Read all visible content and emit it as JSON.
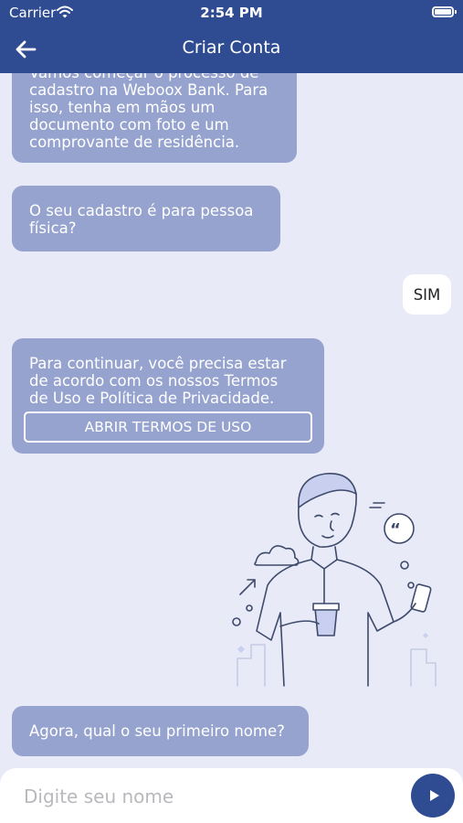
{
  "status_bar": {
    "carrier": "Carrier",
    "time": "2:54 PM"
  },
  "header": {
    "title": "Criar Conta"
  },
  "messages": [
    {
      "from": "bot",
      "lines": [
        "Vamos começar o processo de",
        "cadastro na Weboox Bank. Para",
        "isso, tenha em mãos um",
        "documento com foto e um",
        "comprovante de residência."
      ]
    },
    {
      "from": "bot",
      "lines": [
        "O seu cadastro é para pessoa",
        "física?"
      ]
    },
    {
      "from": "user",
      "text": "SIM"
    },
    {
      "from": "bot",
      "lines": [
        "Para continuar, você precisa estar",
        "de acordo com os nossos Termos",
        "de Uso e Política de Privacidade."
      ],
      "button": "ABRIR TERMOS DE USO"
    },
    {
      "from": "bot",
      "lines": [
        "Agora, qual o seu primeiro nome?"
      ]
    }
  ],
  "input": {
    "placeholder": "Digite seu nome"
  },
  "colors": {
    "primary": "#2f4c93",
    "bot_bubble": "#96a3cf",
    "background": "#e8eaf7"
  },
  "icons": {
    "back": "arrow-left-icon",
    "send": "play-icon",
    "wifi": "wifi-icon",
    "battery": "battery-icon"
  }
}
